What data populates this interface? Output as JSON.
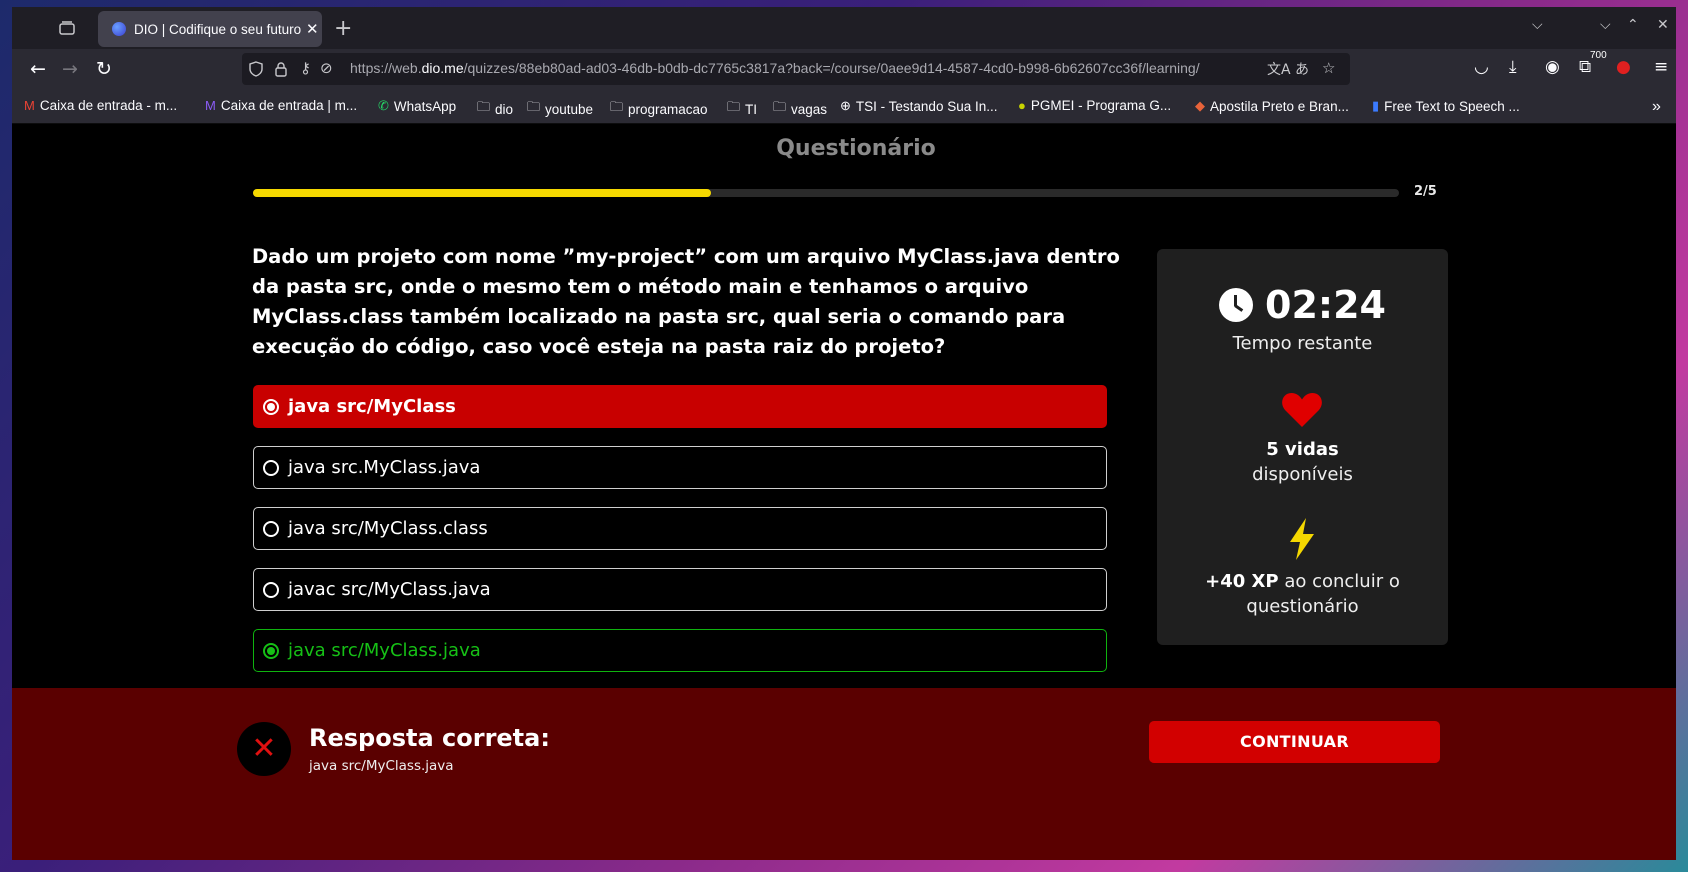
{
  "browser": {
    "tab_title": "DIO | Codifique o seu futuro",
    "url_prefix": "https://web.",
    "url_domain": "dio.me",
    "url_rest": "/quizzes/88eb80ad-ad03-46db-b0db-dc7765c3817a?back=/course/0aee9d14-4587-4cd0-b998-6b62607cc36f/learning/",
    "extension_badge": "700"
  },
  "bookmarks": [
    {
      "label": "Caixa de entrada - m...",
      "icon": "gmail-icon"
    },
    {
      "label": "Caixa de entrada | m...",
      "icon": "mail-icon"
    },
    {
      "label": "WhatsApp",
      "icon": "whatsapp-icon"
    },
    {
      "label": "dio",
      "icon": "folder-icon"
    },
    {
      "label": "youtube",
      "icon": "folder-icon"
    },
    {
      "label": "programacao",
      "icon": "folder-icon"
    },
    {
      "label": "TI",
      "icon": "folder-icon"
    },
    {
      "label": "vagas",
      "icon": "folder-icon"
    },
    {
      "label": "TSI - Testando Sua In...",
      "icon": "globe-icon"
    },
    {
      "label": "PGMEI - Programa G...",
      "icon": "pgmei-icon"
    },
    {
      "label": "Apostila Preto e Bran...",
      "icon": "apostila-icon"
    },
    {
      "label": "Free Text to Speech ...",
      "icon": "tts-icon"
    }
  ],
  "quiz": {
    "title": "Questionário",
    "progress_label": "2/5",
    "progress_fraction": 0.4,
    "question": "Dado um projeto com nome ”my-project” com um arquivo MyClass.java dentro da pasta src, onde o mesmo tem o método main e tenhamos o arquivo MyClass.class também localizado na pasta src, qual seria o comando para execução do código, caso você esteja na pasta raiz do projeto?",
    "options": [
      {
        "label": "java src/MyClass",
        "state": "selected-wrong"
      },
      {
        "label": "java src.MyClass.java",
        "state": "normal"
      },
      {
        "label": "java src/MyClass.class",
        "state": "normal"
      },
      {
        "label": "javac src/MyClass.java",
        "state": "normal"
      },
      {
        "label": "java src/MyClass.java",
        "state": "correct"
      }
    ]
  },
  "sidebar": {
    "timer": "02:24",
    "timer_label": "Tempo restante",
    "lives": "5 vidas",
    "lives_label": "disponíveis",
    "xp": "+40 XP",
    "xp_label": " ao concluir o questionário"
  },
  "feedback": {
    "title": "Resposta correta:",
    "answer": "java src/MyClass.java",
    "continue_label": "CONTINUAR"
  },
  "colors": {
    "progress": "#f5d800",
    "wrong": "#c80000",
    "correct": "#16c016",
    "feedback_bg": "#5a0000"
  }
}
